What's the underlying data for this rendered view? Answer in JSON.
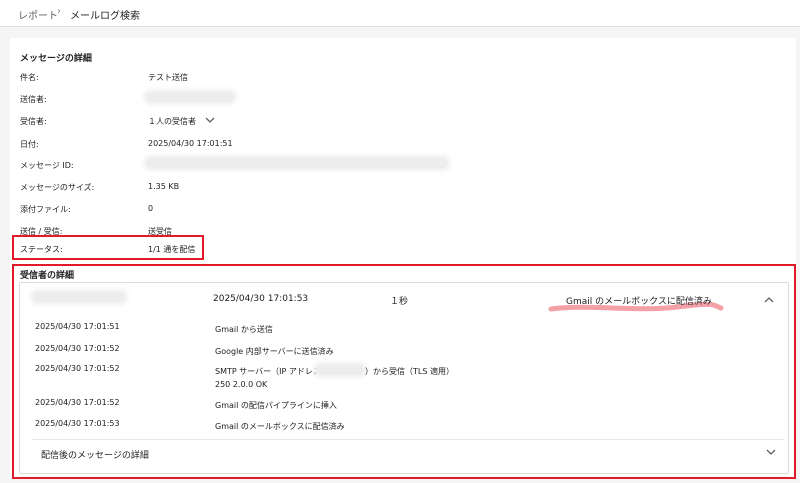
{
  "breadcrumb": {
    "parent": "レポート",
    "separator": "›",
    "current": "メールログ検索"
  },
  "message_details": {
    "title": "メッセージの詳細",
    "rows": [
      {
        "label": "件名:",
        "value": "テスト送信"
      },
      {
        "label": "送信者:",
        "value": ""
      },
      {
        "label": "受信者:",
        "value": "１人の受信者"
      },
      {
        "label": "日付:",
        "value": "2025/04/30 17:01:51"
      },
      {
        "label": "メッセージ ID:",
        "value": ""
      },
      {
        "label": "メッセージのサイズ:",
        "value": "1.35 KB"
      },
      {
        "label": "添付ファイル:",
        "value": "0"
      },
      {
        "label": "送信 / 受信:",
        "value": "送受信"
      },
      {
        "label": "ステータス:",
        "value": "1/1 通を配信"
      }
    ]
  },
  "recipient_details": {
    "title": "受信者の詳細",
    "summary": {
      "date": "2025/04/30 17:01:53",
      "duration": "１秒",
      "status": "Gmail のメールボックスに配信済み"
    },
    "events": [
      {
        "time": "2025/04/30 17:01:51",
        "text": "Gmail から送信"
      },
      {
        "time": "2025/04/30 17:01:52",
        "text": "Google 内部サーバーに送信済み"
      },
      {
        "time": "2025/04/30 17:01:52",
        "text_pre": "SMTP サーバー（IP アドレス:",
        "text_post": "）から受信（TLS 適用）",
        "text_line2": "250 2.0.0 OK"
      },
      {
        "time": "2025/04/30 17:01:52",
        "text": "Gmail の配信パイプラインに挿入"
      },
      {
        "time": "2025/04/30 17:01:53",
        "text": "Gmail のメールボックスに配信済み"
      }
    ],
    "post_delivery_label": "配信後のメッセージの詳細"
  },
  "colors": {
    "highlight_box": "#e21b2a",
    "marker": "#f4a0a7"
  },
  "icons": [
    "chevron-right-icon",
    "chevron-down-icon",
    "chevron-up-icon"
  ]
}
